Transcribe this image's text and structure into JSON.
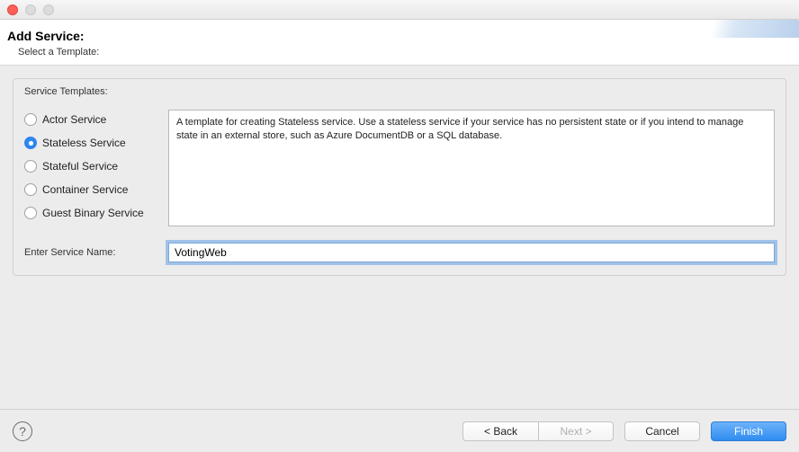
{
  "header": {
    "title": "Add Service:",
    "subtitle": "Select a Template:"
  },
  "group": {
    "label": "Service Templates:"
  },
  "templates": [
    {
      "label": "Actor Service",
      "selected": false
    },
    {
      "label": "Stateless Service",
      "selected": true
    },
    {
      "label": "Stateful Service",
      "selected": false
    },
    {
      "label": "Container Service",
      "selected": false
    },
    {
      "label": "Guest Binary Service",
      "selected": false
    }
  ],
  "description": "A template for creating Stateless service.  Use a stateless service if your service has no persistent state or if you intend to manage state in an external store, such as Azure DocumentDB or a SQL database.",
  "serviceName": {
    "label": "Enter Service Name:",
    "value": "VotingWeb"
  },
  "footer": {
    "help": "?",
    "back": "< Back",
    "next": "Next >",
    "cancel": "Cancel",
    "finish": "Finish"
  }
}
